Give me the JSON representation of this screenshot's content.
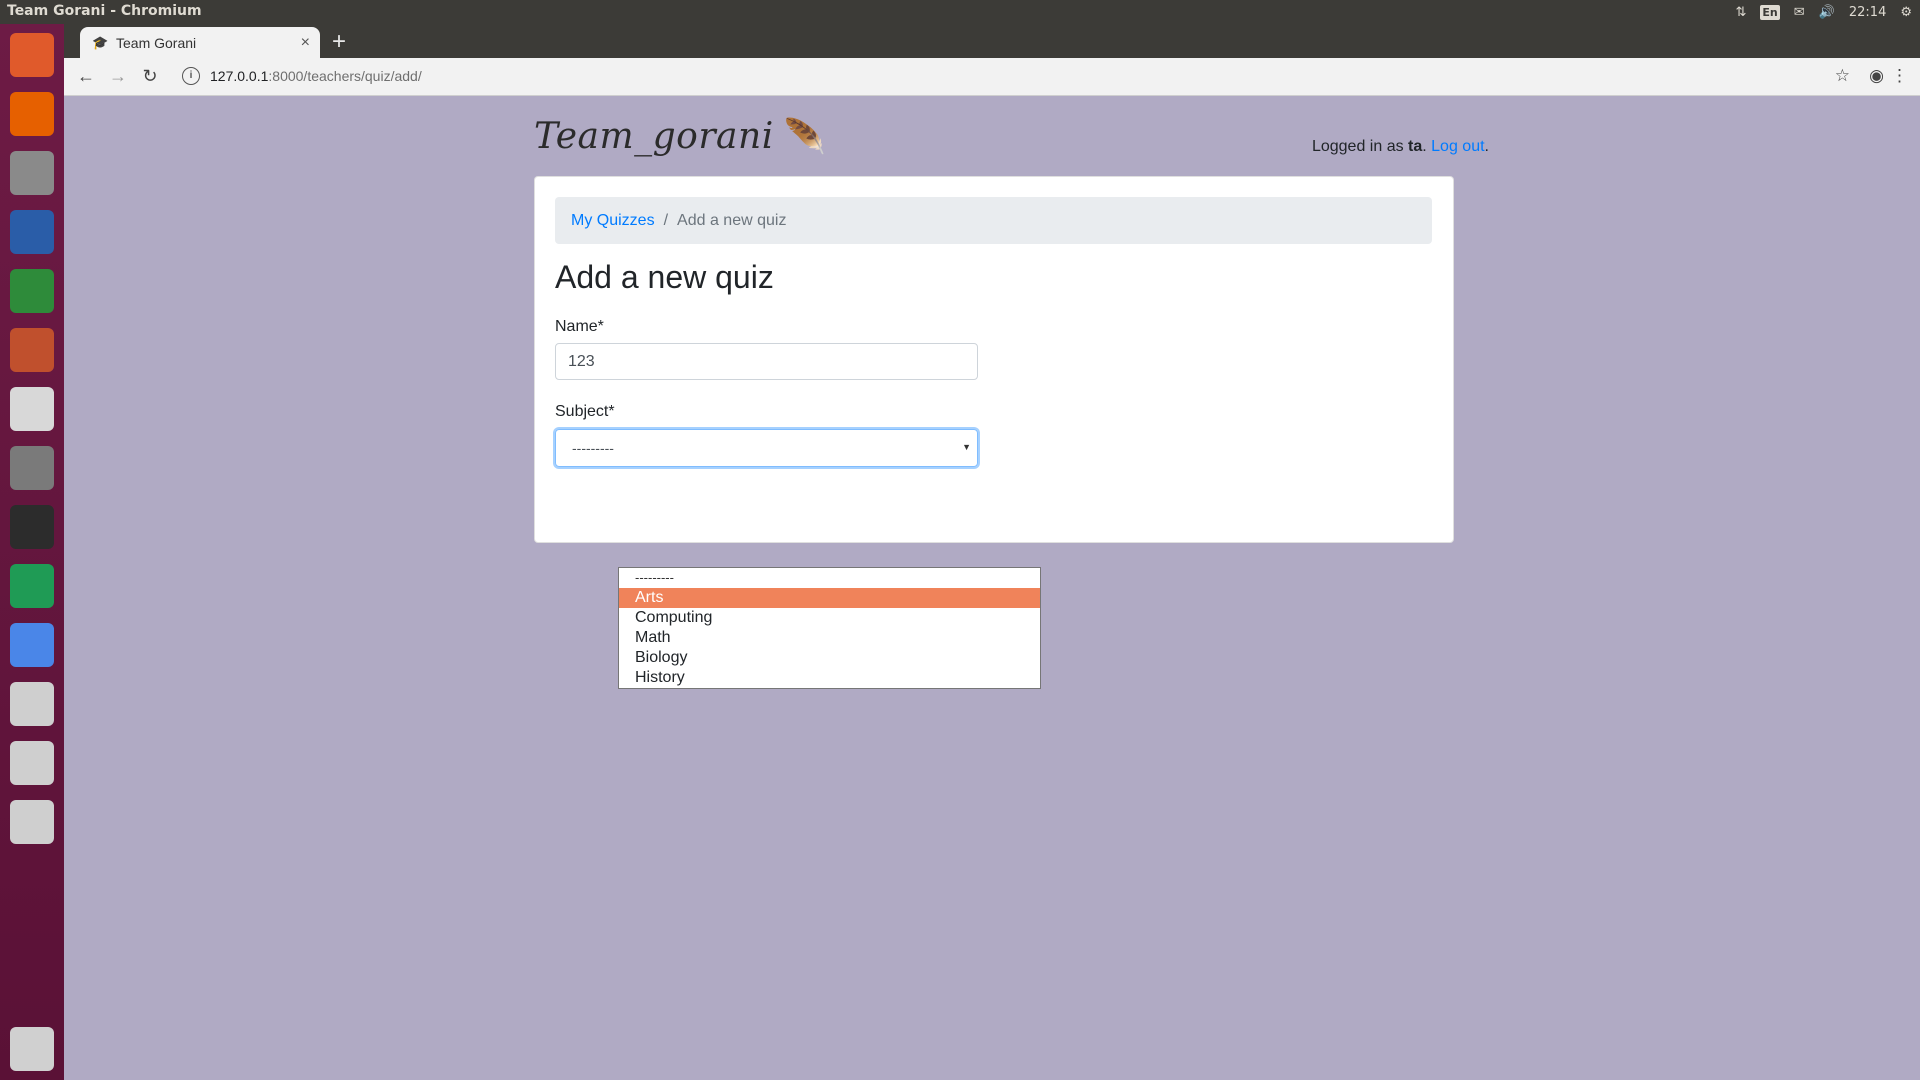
{
  "system": {
    "window_title": "Team Gorani - Chromium",
    "keyboard_layout": "En",
    "clock": "22:14"
  },
  "launcher": {
    "apps": [
      {
        "name": "ubuntu-dash-icon",
        "color": "#e05a2b"
      },
      {
        "name": "firefox-icon",
        "color": "#e66000"
      },
      {
        "name": "files-icon",
        "color": "#8a8a8a"
      },
      {
        "name": "writer-icon",
        "color": "#2a5da8"
      },
      {
        "name": "calc-icon",
        "color": "#2e8b3a"
      },
      {
        "name": "impress-icon",
        "color": "#c0502d"
      },
      {
        "name": "software-center-icon",
        "color": "#d8d8d8"
      },
      {
        "name": "system-settings-icon",
        "color": "#7a7a7a"
      },
      {
        "name": "terminal-icon",
        "color": "#2c2c2c"
      },
      {
        "name": "pycharm-icon",
        "color": "#1f9b55"
      },
      {
        "name": "chromium-icon",
        "color": "#4a86e8"
      },
      {
        "name": "drive-icon",
        "color": "#cfcfcf"
      },
      {
        "name": "drive-icon",
        "color": "#cfcfcf"
      },
      {
        "name": "drive-icon",
        "color": "#cfcfcf"
      },
      {
        "name": "trash-icon",
        "color": "#d0d0d0"
      }
    ]
  },
  "browser": {
    "tab_title": "Team Gorani",
    "url_host": "127.0.0.1",
    "url_path": ":8000/teachers/quiz/add/"
  },
  "site": {
    "brand": "Team_gorani",
    "login_prefix": "Logged in as ",
    "username": "ta",
    "login_dot": ". ",
    "logout_label": "Log out",
    "logout_suffix": "."
  },
  "breadcrumb": {
    "parent": "My Quizzes",
    "separator": "/",
    "current": "Add a new quiz"
  },
  "form": {
    "title": "Add a new quiz",
    "name_label": "Name*",
    "name_value": "123",
    "subject_label": "Subject*",
    "subject_value": "---------",
    "subject_options": [
      "---------",
      "Arts",
      "Computing",
      "Math",
      "Biology",
      "History"
    ],
    "highlighted_option": "Arts"
  },
  "colors": {
    "page_bg": "#b0aac4",
    "link": "#007bff",
    "highlight": "#f0835a"
  }
}
